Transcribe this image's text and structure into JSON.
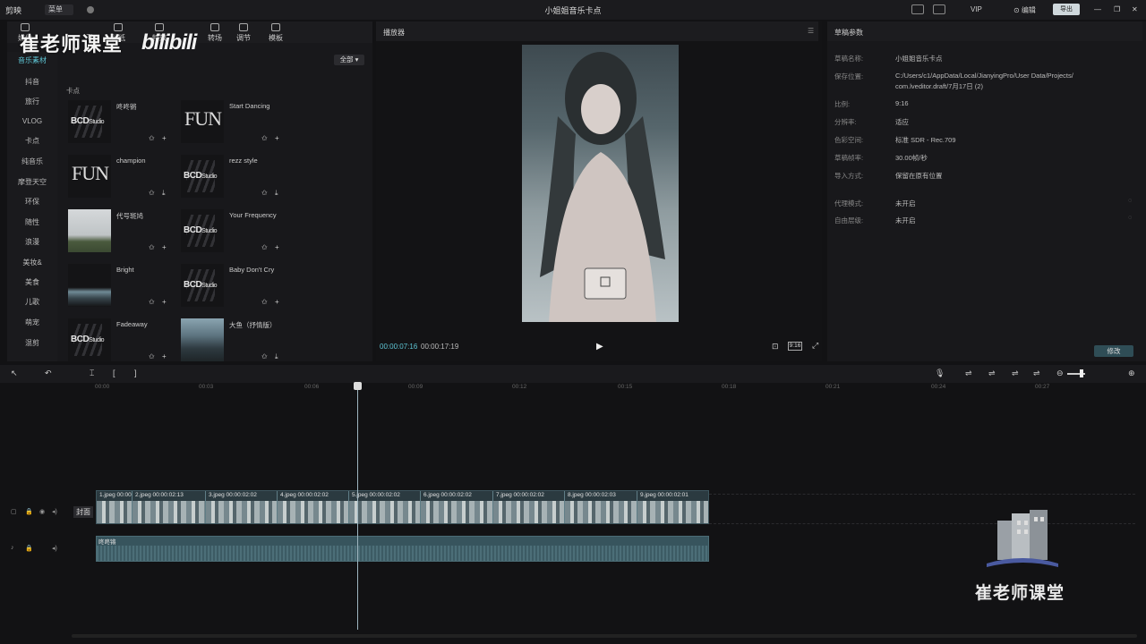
{
  "titlebar": {
    "app_name": "剪映",
    "menu_label": "菜单",
    "title": "小姐姐音乐卡点",
    "vip_label": "VIP",
    "publish_label": "导出"
  },
  "tools": [
    {
      "label": "媒体"
    },
    {
      "label": "TI"
    },
    {
      "label": "贴纸"
    },
    {
      "label": "特效"
    },
    {
      "label": "转场"
    },
    {
      "label": "调节"
    },
    {
      "label": "模板"
    }
  ],
  "media": {
    "filter_label": "全部 ▾",
    "section_label": "卡点",
    "nav_items": [
      "音乐素材",
      "抖音",
      "旅行",
      "VLOG",
      "卡点",
      "纯音乐",
      "摩登天空",
      "环保",
      "随性",
      "浪漫",
      "美妆&",
      "美食",
      "儿歌",
      "萌宠",
      "混剪"
    ],
    "cards": [
      {
        "name": "咚咚锵",
        "thumb": "bcd"
      },
      {
        "name": "Start Dancing",
        "thumb": "fun"
      },
      {
        "name": "champion",
        "thumb": "fun"
      },
      {
        "name": "rezz style",
        "thumb": "bcd"
      },
      {
        "name": "代号斑鸠",
        "thumb": "photo"
      },
      {
        "name": "Your Frequency",
        "thumb": "bcd"
      },
      {
        "name": "Bright",
        "thumb": "dark"
      },
      {
        "name": "Baby Don't Cry",
        "thumb": "bcd"
      },
      {
        "name": "Fadeaway",
        "thumb": "bcd"
      },
      {
        "name": "大鱼（抒情版）",
        "thumb": "city"
      }
    ]
  },
  "watermark": {
    "text": "崔老师课堂",
    "bili": "bilibili",
    "bottom_text": "崔老师课堂"
  },
  "player": {
    "title": "播放器",
    "time_current": "00:00:07:16",
    "time_total": "00:00:17:19",
    "ratio_label": "9:16"
  },
  "params": {
    "title": "草稿参数",
    "rows": [
      {
        "label": "草稿名称:",
        "value": "小姐姐音乐卡点"
      },
      {
        "label": "保存位置:",
        "value": "C:/Users/c1/AppData/Local/JianyingPro/User Data/Projects/"
      },
      {
        "label": "",
        "value": "com.lveditor.draft/7月17日 (2)"
      },
      {
        "label": "比例:",
        "value": "9:16"
      },
      {
        "label": "分辨率:",
        "value": "适应"
      },
      {
        "label": "色彩空间:",
        "value": "标准 SDR - Rec.709"
      },
      {
        "label": "草稿帧率:",
        "value": "30.00帧/秒"
      },
      {
        "label": "导入方式:",
        "value": "保留在原有位置"
      },
      {
        "label": "代理模式:",
        "value": "未开启"
      },
      {
        "label": "自由层级:",
        "value": "未开启"
      }
    ],
    "edit_label": "修改"
  },
  "timeline": {
    "ruler": [
      "00:00",
      "00:03",
      "00:06",
      "00:09",
      "00:12",
      "00:15",
      "00:18",
      "00:21",
      "00:24",
      "00:27"
    ],
    "cover_label": "封面",
    "audio_name": "咚咚锵",
    "clips": [
      {
        "label": "1.jpeg  00:00"
      },
      {
        "label": "2.jpeg  00:00:02:13"
      },
      {
        "label": "3.jpeg  00:00:02:02"
      },
      {
        "label": "4.jpeg  00:00:02:02"
      },
      {
        "label": "5.jpeg  00:00:02:02"
      },
      {
        "label": "6.jpeg  00:00:02:02"
      },
      {
        "label": "7.jpeg  00:00:02:02"
      },
      {
        "label": "8.jpeg  00:00:02:03"
      },
      {
        "label": "9.jpeg  00:00:02:01"
      }
    ]
  }
}
